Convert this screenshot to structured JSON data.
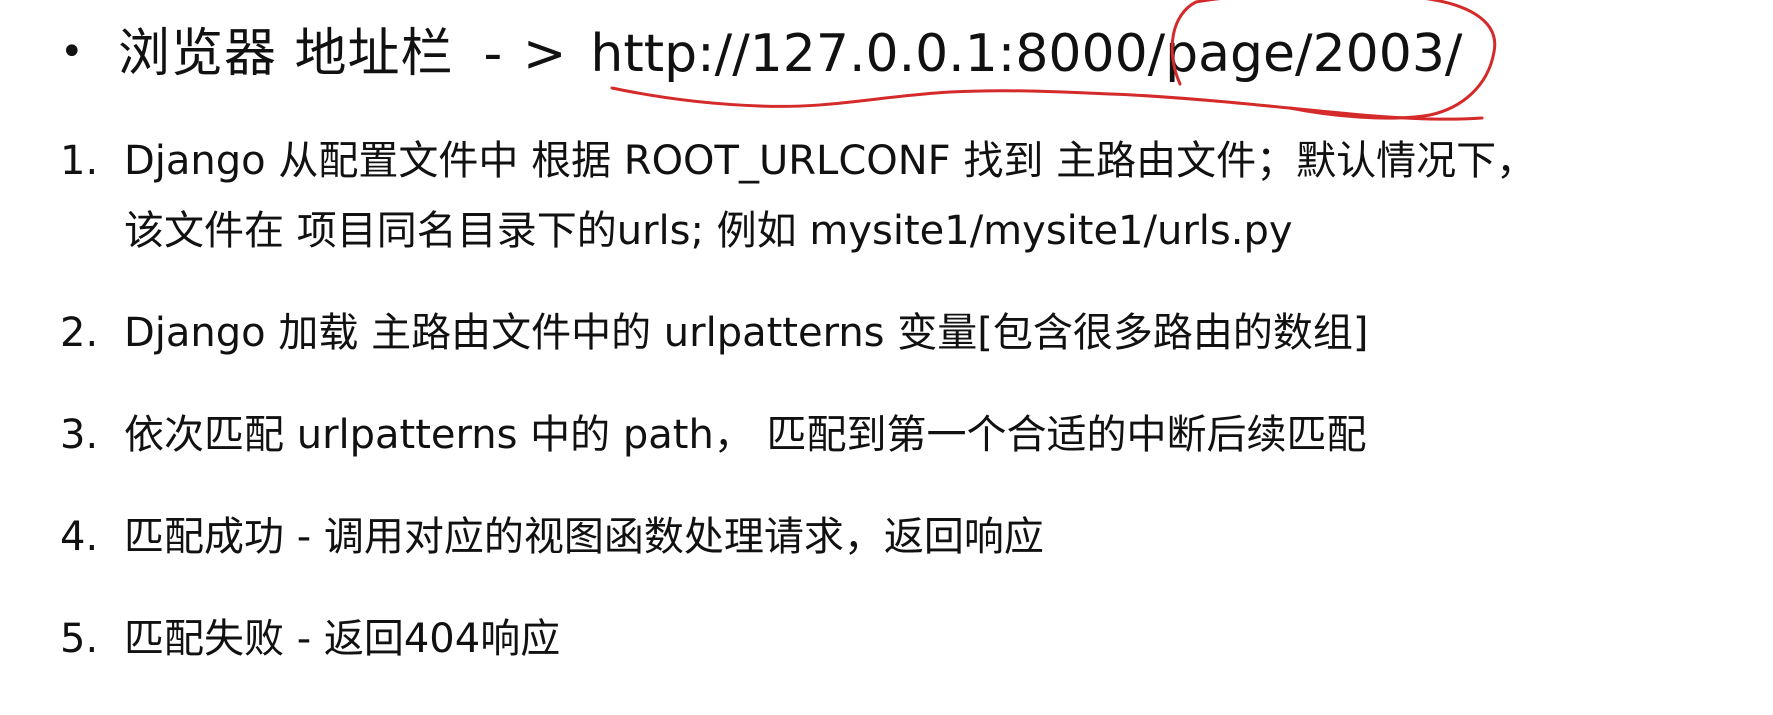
{
  "bullet": {
    "label": "浏览器 地址栏",
    "arrow": "- >",
    "url": "http://127.0.0.1:8000/page/2003/"
  },
  "steps": [
    {
      "number": "1.",
      "line1": "Django 从配置文件中 根据 ROOT_URLCONF 找到 主路由文件；默认情况下，",
      "line2": "该文件在 项目同名目录下的urls; 例如 mysite1/mysite1/urls.py"
    },
    {
      "number": "2.",
      "line1": "Django 加载 主路由文件中的 urlpatterns 变量[包含很多路由的数组]"
    },
    {
      "number": "3.",
      "line1": "依次匹配 urlpatterns 中的 path， 匹配到第一个合适的中断后续匹配"
    },
    {
      "number": "4.",
      "line1": "匹配成功 - 调用对应的视图函数处理请求，返回响应"
    },
    {
      "number": "5.",
      "line1": "匹配失败 - 返回404响应"
    }
  ],
  "annotation": {
    "color": "#d42a2a"
  }
}
